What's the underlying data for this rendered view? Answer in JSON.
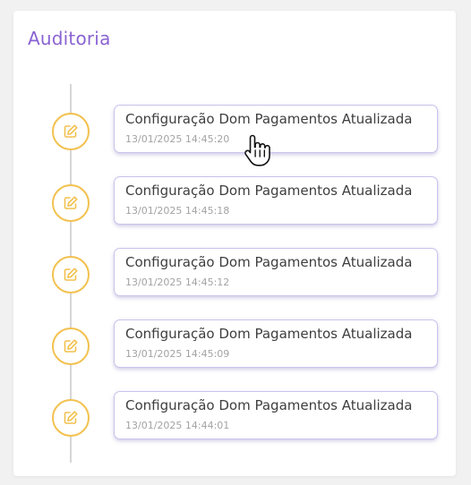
{
  "panel": {
    "title": "Auditoria"
  },
  "timeline": {
    "accent_color": "#f2c14e",
    "icon": "edit-icon",
    "items": [
      {
        "title": "Configuração Dom Pagamentos Atualizada",
        "date": "13/01/2025 14:45:20"
      },
      {
        "title": "Configuração Dom Pagamentos Atualizada",
        "date": "13/01/2025 14:45:18"
      },
      {
        "title": "Configuração Dom Pagamentos Atualizada",
        "date": "13/01/2025 14:45:12"
      },
      {
        "title": "Configuração Dom Pagamentos Atualizada",
        "date": "13/01/2025 14:45:09"
      },
      {
        "title": "Configuração Dom Pagamentos Atualizada",
        "date": "13/01/2025 14:44:01"
      }
    ]
  },
  "cursor": {
    "icon": "hand-pointer-icon"
  }
}
